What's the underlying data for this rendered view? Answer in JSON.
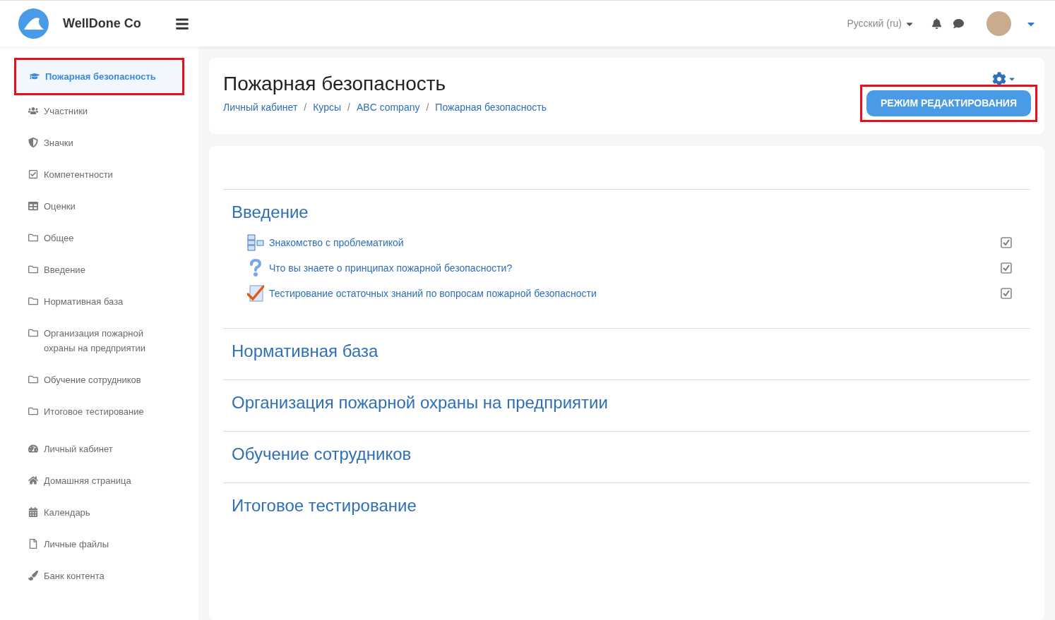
{
  "header": {
    "site_name": "WellDone Co",
    "language": "Русский (ru)"
  },
  "course_nav": [
    {
      "label": "Пожарная безопасность",
      "kind": "course",
      "selected": true,
      "highlighted": true
    },
    {
      "label": "Участники",
      "kind": "users",
      "selected": false,
      "highlighted": false
    },
    {
      "label": "Значки",
      "kind": "badge",
      "selected": false,
      "highlighted": false
    },
    {
      "label": "Компетентности",
      "kind": "competency",
      "selected": false,
      "highlighted": false
    },
    {
      "label": "Оценки",
      "kind": "grades",
      "selected": false,
      "highlighted": false
    },
    {
      "label": "Общее",
      "kind": "folder",
      "selected": false,
      "highlighted": false
    },
    {
      "label": "Введение",
      "kind": "folder",
      "selected": false,
      "highlighted": false
    },
    {
      "label": "Нормативная база",
      "kind": "folder",
      "selected": false,
      "highlighted": false
    },
    {
      "label": "Организация пожарной охраны на предприятии",
      "kind": "folder",
      "selected": false,
      "highlighted": false
    },
    {
      "label": "Обучение сотрудников",
      "kind": "folder",
      "selected": false,
      "highlighted": false
    },
    {
      "label": "Итоговое тестирование",
      "kind": "folder",
      "selected": false,
      "highlighted": false
    }
  ],
  "site_nav": [
    {
      "label": "Личный кабинет",
      "kind": "dashboard",
      "selected": false,
      "highlighted": false
    },
    {
      "label": "Домашняя страница",
      "kind": "home",
      "selected": false,
      "highlighted": false
    },
    {
      "label": "Календарь",
      "kind": "calendar",
      "selected": false,
      "highlighted": false
    },
    {
      "label": "Личные файлы",
      "kind": "files",
      "selected": false,
      "highlighted": false
    },
    {
      "label": "Банк контента",
      "kind": "brush",
      "selected": false,
      "highlighted": false
    }
  ],
  "page_header": {
    "title": "Пожарная безопасность",
    "breadcrumb_separator": "/",
    "breadcrumbs": [
      "Личный кабинет",
      "Курсы",
      "ABC company",
      "Пожарная безопасность"
    ],
    "edit_button": {
      "label": "РЕЖИМ РЕДАКТИРОВАНИЯ",
      "highlighted": true
    }
  },
  "sections": [
    {
      "title": "Введение",
      "activities": [
        {
          "kind": "page",
          "label": "Знакомство с проблематикой",
          "completed": true
        },
        {
          "kind": "feedback",
          "label": "Что вы знаете о принципах пожарной безопасности?",
          "completed": true
        },
        {
          "kind": "quiz",
          "label": "Тестирование остаточных знаний по вопросам пожарной безопасности",
          "completed": true
        }
      ]
    },
    {
      "title": "Нормативная база"
    },
    {
      "title": "Организация пожарной охраны на предприятии"
    },
    {
      "title": "Обучение сотрудников"
    },
    {
      "title": "Итоговое тестирование"
    }
  ]
}
